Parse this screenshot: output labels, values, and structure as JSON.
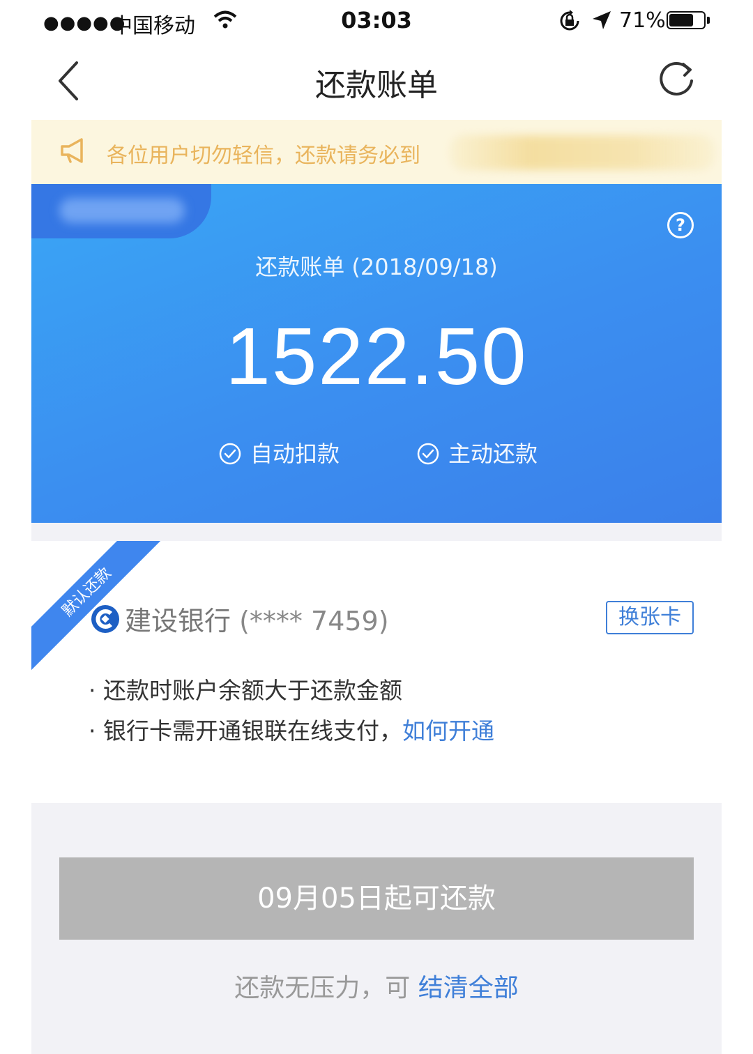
{
  "status_bar": {
    "signal": "●●●●●",
    "carrier": "中国移动",
    "time": "03:03",
    "battery_pct": "71%",
    "battery_level": 0.71,
    "icons": [
      "wifi-icon",
      "orientation-lock-icon",
      "location-arrow-icon",
      "battery-icon"
    ]
  },
  "nav": {
    "title": "还款账单",
    "icons": [
      "back-chevron-icon",
      "refresh-icon"
    ]
  },
  "notice": {
    "text": "各位用户切勿轻信，还款请务必到",
    "icon": "megaphone-icon",
    "color": "#e9b45c"
  },
  "bill": {
    "title": "还款账单 (2018/09/18)",
    "amount": "1522.50",
    "options": [
      "自动扣款",
      "主动还款"
    ],
    "help_symbol": "?",
    "accent": "#3b8ef0"
  },
  "card": {
    "ribbon": "默认还款",
    "bank_name": "建设银行",
    "card_number": "(**** 7459)",
    "change_button": "换张卡",
    "tips": [
      "还款时账户余额大于还款金额",
      "银行卡需开通银联在线支付，"
    ],
    "tip_link": "如何开通",
    "bullet": "·",
    "link_color": "#3f7fd8"
  },
  "bottom": {
    "button": "09月05日起可还款",
    "settle_text": "还款无压力，可 ",
    "settle_link": "结清全部",
    "button_color": "#b5b5b5"
  }
}
